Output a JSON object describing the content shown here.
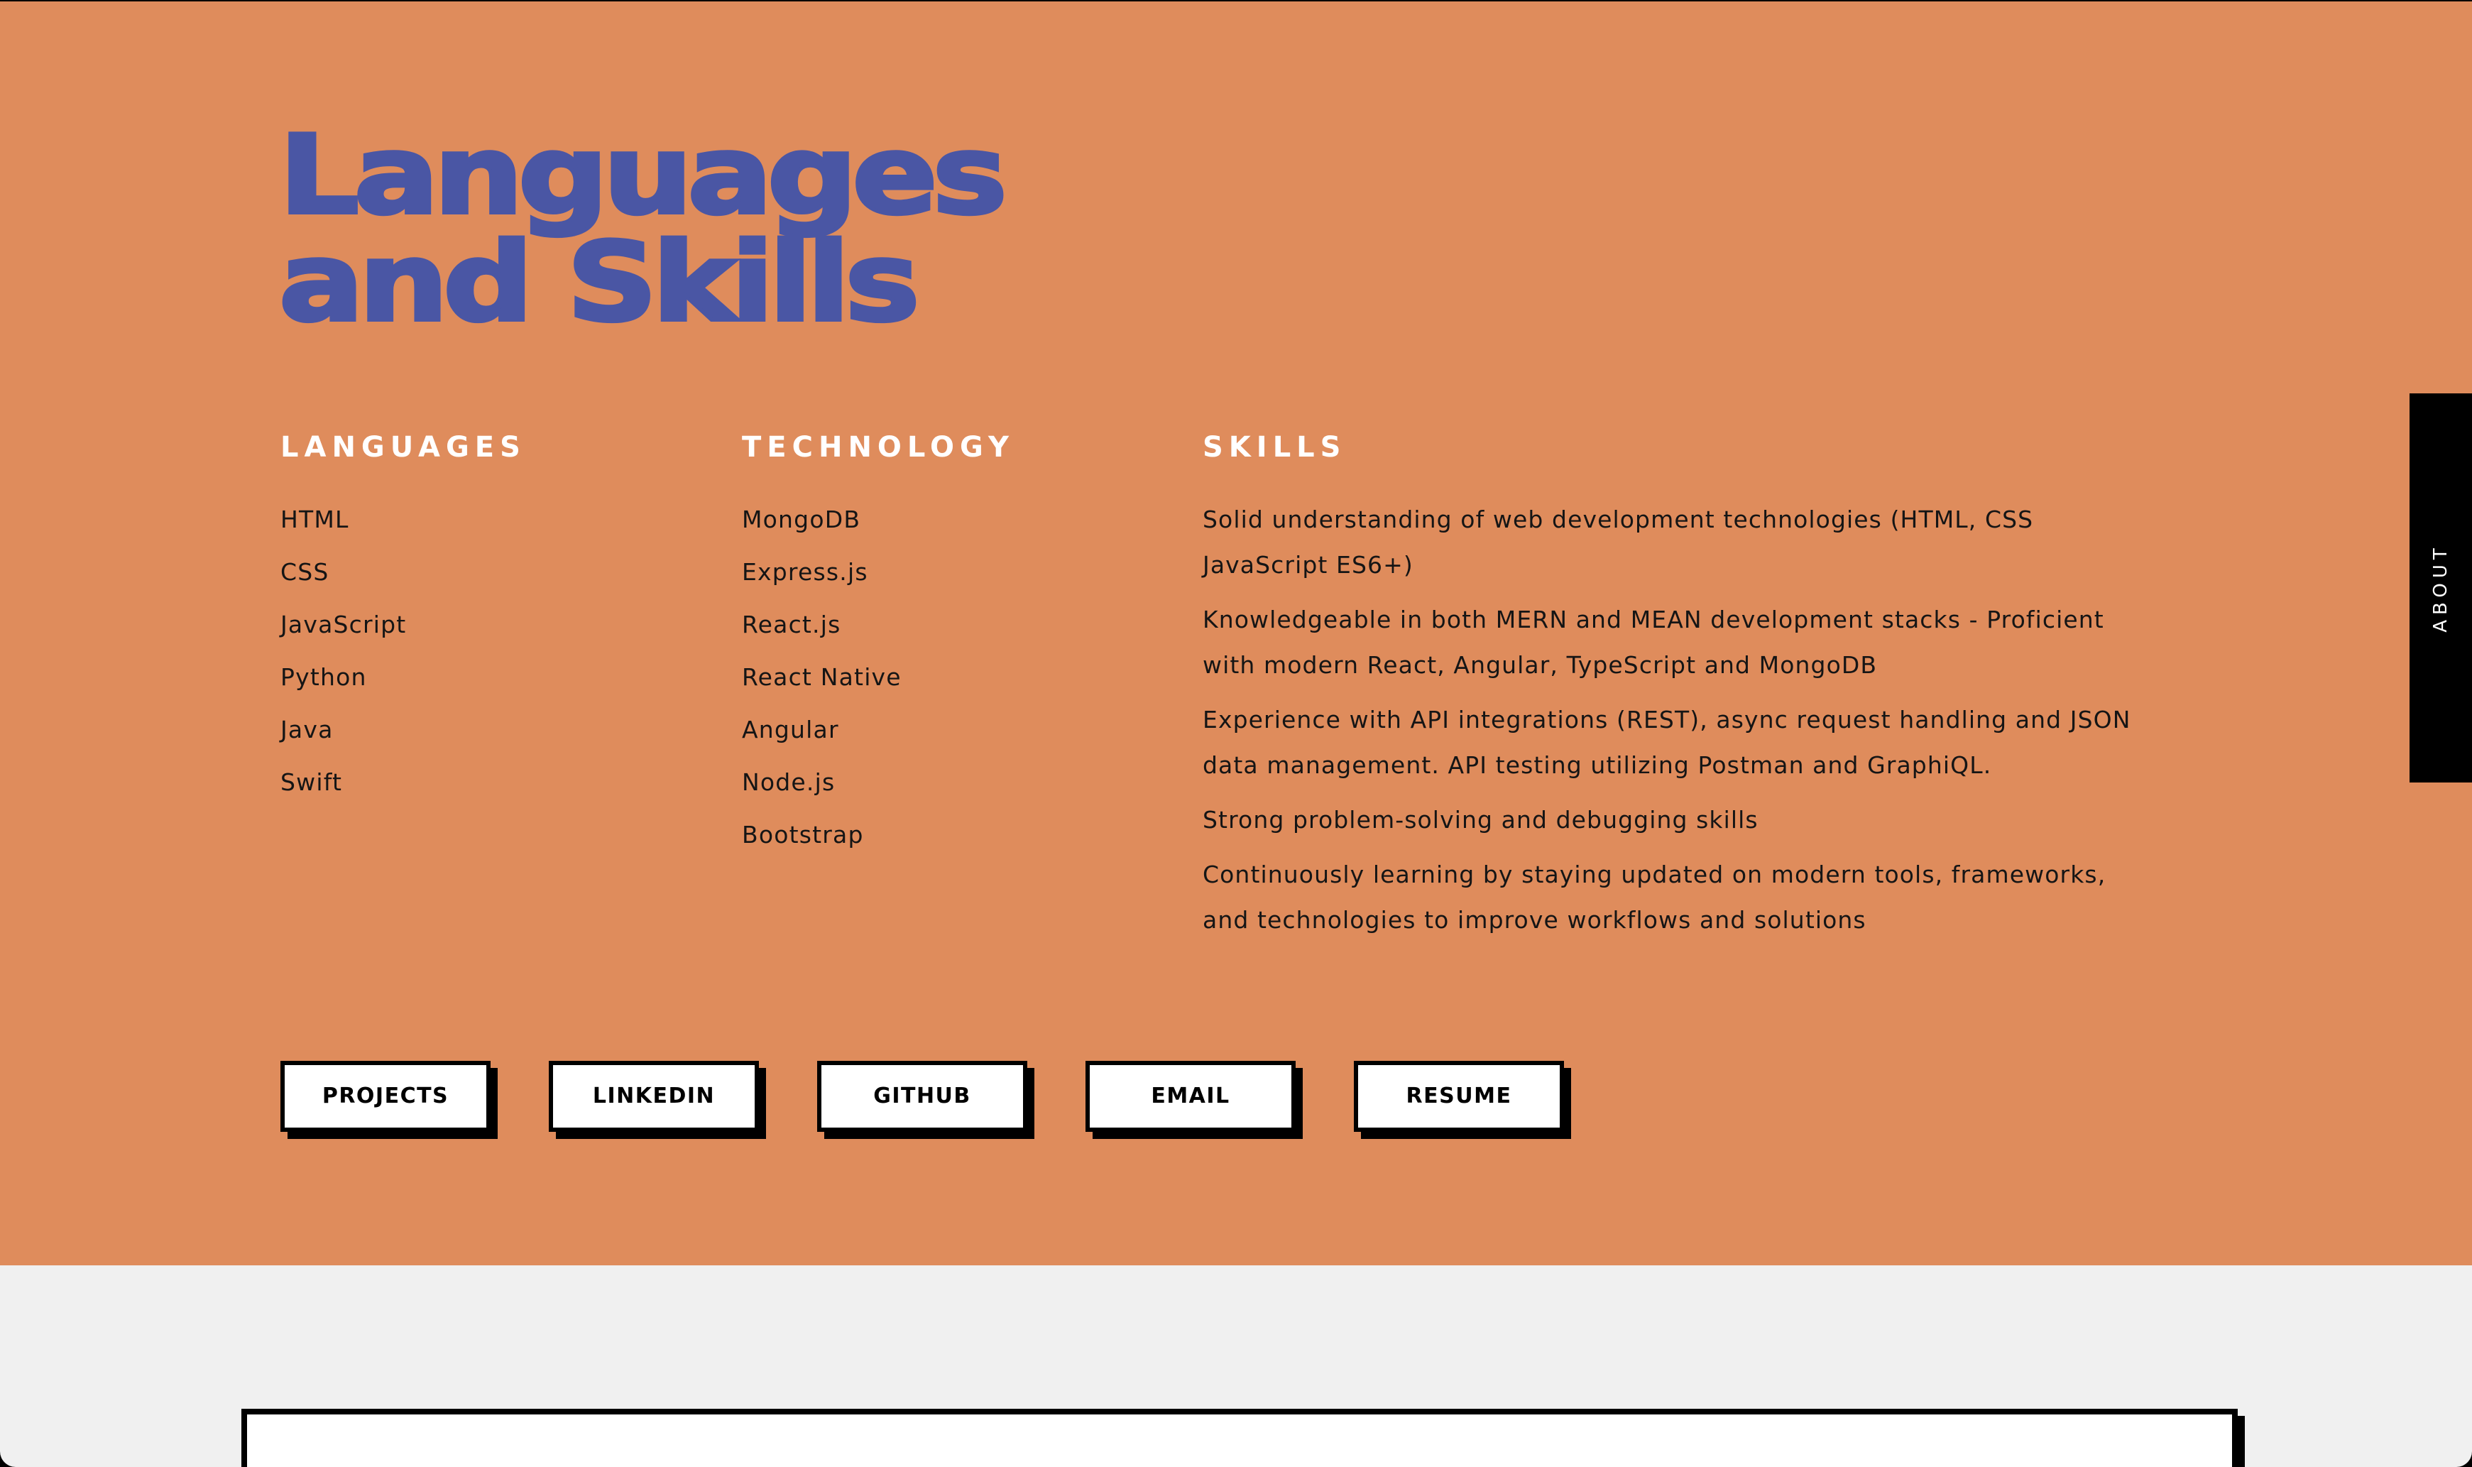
{
  "section": {
    "title_line_1": "Languages",
    "title_line_2": "and Skills"
  },
  "languages": {
    "heading": "LANGUAGES",
    "items": [
      "HTML",
      "CSS",
      "JavaScript",
      "Python",
      "Java",
      "Swift"
    ]
  },
  "technology": {
    "heading": "TECHNOLOGY",
    "items": [
      "MongoDB",
      "Express.js",
      "React.js",
      "React Native",
      "Angular",
      "Node.js",
      "Bootstrap"
    ]
  },
  "skills": {
    "heading": "SKILLS",
    "items": [
      "Solid understanding of web development technologies (HTML, CSS JavaScript ES6+)",
      "Knowledgeable in both MERN and MEAN development stacks - Proficient with modern React, Angular, TypeScript and MongoDB",
      "Experience with API integrations (REST), async request handling and JSON data management. API testing utilizing Postman and GraphiQL.",
      "Strong problem-solving and debugging skills",
      "Continuously learning by staying updated on modern tools, frameworks, and technologies to improve workflows and solutions"
    ]
  },
  "buttons": {
    "projects": "PROJECTS",
    "linkedin": "LINKEDIN",
    "github": "GITHUB",
    "email": "EMAIL",
    "resume": "RESUME"
  },
  "side_tab": {
    "label": "ABOUT"
  },
  "colors": {
    "section_background": "#df8c5c",
    "title": "#4a56a4",
    "heading": "#ffffff",
    "page_background": "#f0f0f0",
    "side_tab": "#000000"
  }
}
